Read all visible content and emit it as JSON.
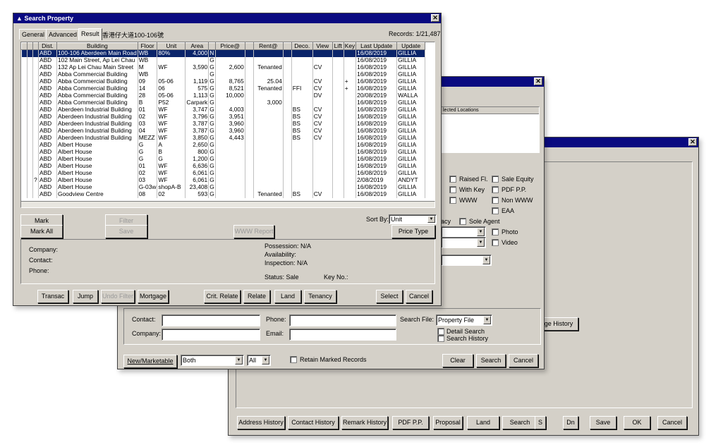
{
  "win3": {
    "buttons": [
      "Address History",
      "Contact History",
      "Remark History",
      "PDF P.P.",
      "Proposal",
      "Land",
      "Search",
      "S",
      "Dn",
      "Save",
      "OK",
      "Cancel"
    ],
    "page_history": "ge History"
  },
  "win2": {
    "sel_locations_label": "lected Locations",
    "checks": [
      "Raised Fl.",
      "Sale Equity",
      "With Key",
      "PDF P.P.",
      "WWW",
      "Non WWW",
      "EAA",
      "acy",
      "Sole Agent",
      "Photo",
      "Video"
    ],
    "contact_label": "Contact:",
    "company_label": "Company:",
    "phone_label": "Phone:",
    "email_label": "Email:",
    "search_file_label": "Search File:",
    "search_file_value": "Property File",
    "detail_search": "Detail Search",
    "search_history": "Search History",
    "new_marketable": "New/Marketable",
    "both": "Both",
    "all": "All",
    "retain": "Retain Marked Records",
    "clear": "Clear",
    "search": "Search",
    "cancel": "Cancel"
  },
  "win1": {
    "title": "Search Property",
    "tabs": [
      "General",
      "Advanced",
      "Result"
    ],
    "search_text": "香港仔大道100-106號",
    "records": "Records: 1/21,487",
    "columns": [
      "",
      "",
      "",
      "Dist.",
      "Building",
      "Floor",
      "Unit",
      "Area",
      "",
      "Price@",
      "",
      "Rent@",
      "",
      "Deco.",
      "View",
      "Lift",
      "Key",
      "Last Update",
      "Update"
    ],
    "rows": [
      [
        "",
        "",
        "",
        "ABD",
        "100-106 Aberdeen Main Road",
        "WB",
        "80%",
        "4,000",
        "N",
        "",
        "",
        "",
        "",
        "",
        "",
        "",
        "",
        "16/08/2019",
        "GILLIA"
      ],
      [
        "",
        "",
        "",
        "ABD",
        "102 Main Street, Ap Lei Chau",
        "WB",
        "",
        "",
        "G",
        "",
        "",
        "",
        "",
        "",
        "",
        "",
        "",
        "16/08/2019",
        "GILLIA"
      ],
      [
        "",
        "",
        "",
        "ABD",
        "132 Ap Lei Chau Main Street",
        "M",
        "WF",
        "3,590",
        "G",
        "2,600",
        "",
        "Tenanted",
        "",
        "",
        "CV",
        "",
        "",
        "16/08/2019",
        "GILLIA"
      ],
      [
        "",
        "",
        "",
        "ABD",
        "Abba Commercial Building",
        "WB",
        "",
        "",
        "G",
        "",
        "",
        "",
        "",
        "",
        "",
        "",
        "",
        "16/08/2019",
        "GILLIA"
      ],
      [
        "",
        "",
        "",
        "ABD",
        "Abba Commercial Building",
        "09",
        "05-06",
        "1,119",
        "G",
        "8,765",
        "",
        "25.04",
        "",
        "",
        "CV",
        "",
        "+",
        "16/08/2019",
        "GILLIA"
      ],
      [
        "",
        "",
        "",
        "ABD",
        "Abba Commercial Building",
        "14",
        "06",
        "575",
        "G",
        "8,521",
        "",
        "Tenanted",
        "",
        "FFI",
        "CV",
        "",
        "+",
        "16/08/2019",
        "GILLIA"
      ],
      [
        "",
        "",
        "",
        "ABD",
        "Abba Commercial Building",
        "28",
        "05-06",
        "1,113",
        "G",
        "10,000",
        "",
        "",
        "",
        "",
        "DV",
        "",
        "",
        "20/08/2019",
        "WALLA"
      ],
      [
        "",
        "",
        "",
        "ABD",
        "Abba Commercial Building",
        "B",
        "P52",
        "Carpark",
        "G",
        "",
        "",
        "3,000",
        "",
        "",
        "",
        "",
        "",
        "16/08/2019",
        "GILLIA"
      ],
      [
        "",
        "",
        "",
        "ABD",
        "Aberdeen Industrial Building",
        "01",
        "WF",
        "3,747",
        "G",
        "4,003",
        "",
        "",
        "",
        "BS",
        "CV",
        "",
        "",
        "16/08/2019",
        "GILLIA"
      ],
      [
        "",
        "",
        "",
        "ABD",
        "Aberdeen Industrial Building",
        "02",
        "WF",
        "3,796",
        "G",
        "3,951",
        "",
        "",
        "",
        "BS",
        "CV",
        "",
        "",
        "16/08/2019",
        "GILLIA"
      ],
      [
        "",
        "",
        "",
        "ABD",
        "Aberdeen Industrial Building",
        "03",
        "WF",
        "3,787",
        "G",
        "3,960",
        "",
        "",
        "",
        "BS",
        "CV",
        "",
        "",
        "16/08/2019",
        "GILLIA"
      ],
      [
        "",
        "",
        "",
        "ABD",
        "Aberdeen Industrial Building",
        "04",
        "WF",
        "3,787",
        "G",
        "3,960",
        "",
        "",
        "",
        "BS",
        "CV",
        "",
        "",
        "16/08/2019",
        "GILLIA"
      ],
      [
        "",
        "",
        "",
        "ABD",
        "Aberdeen Industrial Building",
        "MEZZ",
        "WF",
        "3,850",
        "G",
        "4,443",
        "",
        "",
        "",
        "BS",
        "CV",
        "",
        "",
        "16/08/2019",
        "GILLIA"
      ],
      [
        "",
        "",
        "",
        "ABD",
        "Albert House",
        "G",
        "A",
        "2,650",
        "G",
        "",
        "",
        "",
        "",
        "",
        "",
        "",
        "",
        "16/08/2019",
        "GILLIA"
      ],
      [
        "",
        "",
        "",
        "ABD",
        "Albert House",
        "G",
        "B",
        "800",
        "G",
        "",
        "",
        "",
        "",
        "",
        "",
        "",
        "",
        "16/08/2019",
        "GILLIA"
      ],
      [
        "",
        "",
        "",
        "ABD",
        "Albert House",
        "G",
        "G",
        "1,200",
        "G",
        "",
        "",
        "",
        "",
        "",
        "",
        "",
        "",
        "16/08/2019",
        "GILLIA"
      ],
      [
        "",
        "",
        "",
        "ABD",
        "Albert House",
        "01",
        "WF",
        "6,636",
        "G",
        "",
        "",
        "",
        "",
        "",
        "",
        "",
        "",
        "16/08/2019",
        "GILLIA"
      ],
      [
        "",
        "",
        "",
        "ABD",
        "Albert House",
        "02",
        "WF",
        "6,061",
        "G",
        "",
        "",
        "",
        "",
        "",
        "",
        "",
        "",
        "16/08/2019",
        "GILLIA"
      ],
      [
        "",
        "",
        "?",
        "ABD",
        "Albert House",
        "03",
        "WF",
        "6,061",
        "G",
        "",
        "",
        "",
        "",
        "",
        "",
        "",
        "",
        "2/08/2019",
        "ANDYT"
      ],
      [
        "",
        "",
        "",
        "ABD",
        "Albert House",
        "G-03w",
        "shopA-B",
        "23,408",
        "G",
        "",
        "",
        "",
        "",
        "",
        "",
        "",
        "",
        "16/08/2019",
        "GILLIA"
      ],
      [
        "",
        "",
        "",
        "ABD",
        "Goodview Centre",
        "08",
        "02",
        "593",
        "G",
        "",
        "",
        "Tenanted",
        "",
        "BS",
        "CV",
        "",
        "",
        "16/08/2019",
        "GILLIA"
      ]
    ],
    "mark": "Mark",
    "mark_all": "Mark All",
    "filter": "Filter",
    "save": "Save",
    "www_report": "WWW Report",
    "sort_by": "Sort By:",
    "sort_value": "Unit",
    "price_type": "Price Type",
    "company": "Company:",
    "contact": "Contact:",
    "phone": "Phone:",
    "possession": "Possession: N/A",
    "availability": "Availability:",
    "inspection": "Inspection:  N/A",
    "status": "Status: Sale",
    "key_no": "Key No.:",
    "bottom": [
      "Transac",
      "Jump",
      "Undo Filter",
      "Mortgage",
      "Crit. Relate",
      "Relate",
      "Land",
      "Tenancy",
      "Select",
      "Cancel"
    ]
  }
}
